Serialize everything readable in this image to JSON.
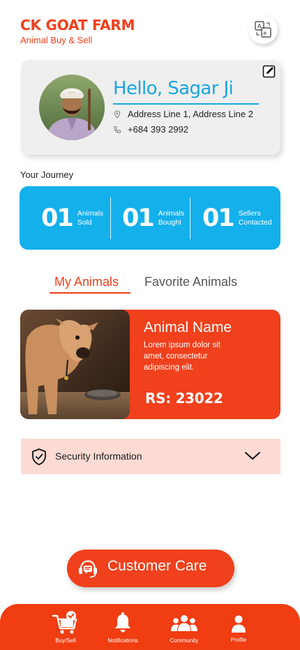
{
  "header": {
    "brand_title": "CK GOAT FARM",
    "brand_subtitle": "Animal Buy & Sell",
    "language_icon": "translate-icon"
  },
  "profile": {
    "greeting": "Hello, Sagar Ji",
    "address": "Address Line 1, Address Line 2",
    "phone": "+684 393 2992",
    "edit_icon": "edit-icon"
  },
  "journey": {
    "label": "Your Journey",
    "stats": [
      {
        "value": "01",
        "line1": "Animals",
        "line2": "Sold"
      },
      {
        "value": "01",
        "line1": "Animals",
        "line2": "Bought"
      },
      {
        "value": "01",
        "line1": "Sellers",
        "line2": "Contacted"
      }
    ]
  },
  "tabs": [
    {
      "label": "My Animals",
      "active": true
    },
    {
      "label": "Favorite Animals",
      "active": false
    }
  ],
  "animal": {
    "name": "Animal Name",
    "description": "Lorem ipsum dolor sit amet, consectetur adipiscing elit.",
    "price": "RS: 23022"
  },
  "security": {
    "label": "Security Information",
    "icon": "shield-check-icon"
  },
  "customer_care": {
    "label": "Customer Care",
    "icon": "headset-icon"
  },
  "bottom_nav": [
    {
      "label": "Buy/Sell",
      "icon": "cart-check-icon"
    },
    {
      "label": "Notifications",
      "icon": "bell-icon"
    },
    {
      "label": "Community",
      "icon": "community-icon"
    },
    {
      "label": "Profile",
      "icon": "user-icon"
    }
  ],
  "colors": {
    "brand_orange": "#f0401c",
    "journey_blue": "#14b0ec",
    "security_bg": "#fddbd4",
    "card_gray": "#efefef"
  }
}
